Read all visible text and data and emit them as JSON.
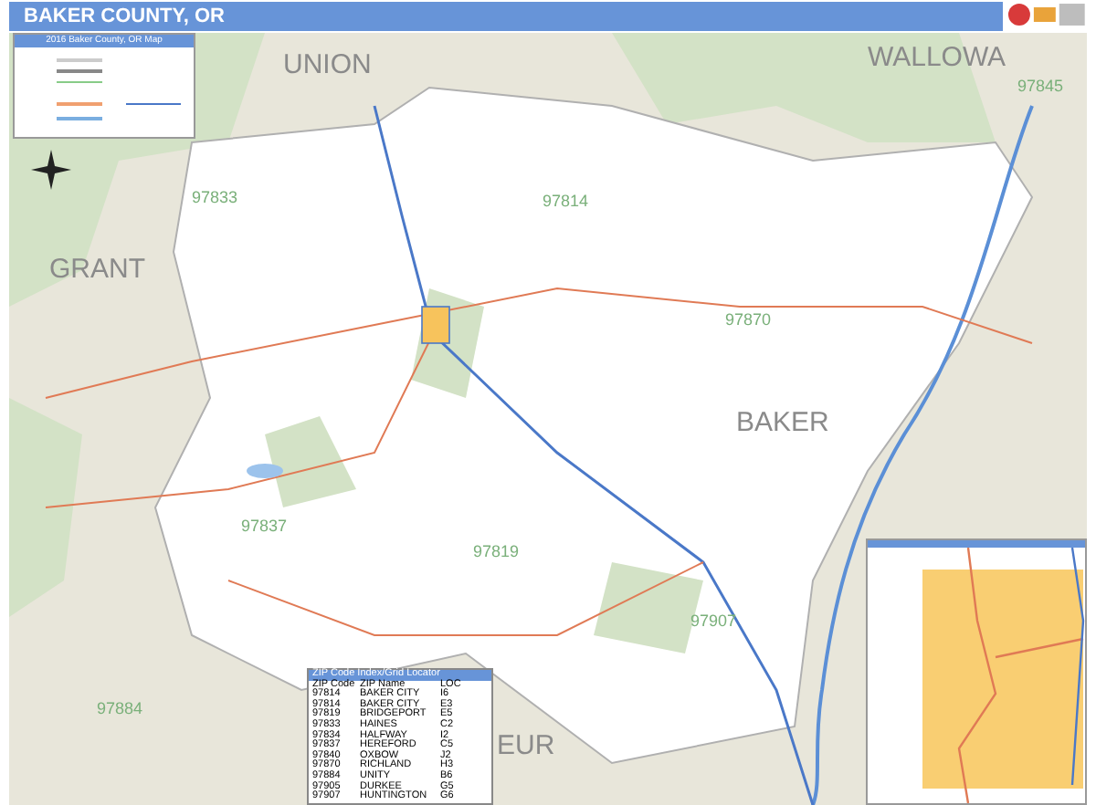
{
  "header": {
    "title": "BAKER COUNTY, OR"
  },
  "legend": {
    "title": "2016 Baker County, OR Map"
  },
  "map_labels": [
    {
      "text": "UNION",
      "kind": "county"
    },
    {
      "text": "WALLOWA",
      "kind": "county"
    },
    {
      "text": "GRANT",
      "kind": "county"
    },
    {
      "text": "BAKER",
      "kind": "county"
    },
    {
      "text": "EUR",
      "kind": "county"
    },
    {
      "text": "97845",
      "kind": "zip"
    },
    {
      "text": "97814",
      "kind": "zip"
    },
    {
      "text": "97833",
      "kind": "zip"
    },
    {
      "text": "97870",
      "kind": "zip"
    },
    {
      "text": "97837",
      "kind": "zip"
    },
    {
      "text": "97819",
      "kind": "zip"
    },
    {
      "text": "97907",
      "kind": "zip"
    },
    {
      "text": "97884",
      "kind": "zip"
    }
  ],
  "zip_table": {
    "title": "ZIP Code Index/Grid Locator",
    "columns": [
      "ZIP Code",
      "ZIP Name",
      "LOC"
    ],
    "rows": [
      [
        "97814",
        "BAKER CITY",
        "I6"
      ],
      [
        "97814",
        "BAKER CITY",
        "E3"
      ],
      [
        "97819",
        "BRIDGEPORT",
        "E5"
      ],
      [
        "97833",
        "HAINES",
        "C2"
      ],
      [
        "97834",
        "HALFWAY",
        "I2"
      ],
      [
        "97837",
        "HEREFORD",
        "C5"
      ],
      [
        "97840",
        "OXBOW",
        "J2"
      ],
      [
        "97870",
        "RICHLAND",
        "H3"
      ],
      [
        "97884",
        "UNITY",
        "B6"
      ],
      [
        "97905",
        "DURKEE",
        "G5"
      ],
      [
        "97907",
        "HUNTINGTON",
        "G6"
      ]
    ]
  }
}
